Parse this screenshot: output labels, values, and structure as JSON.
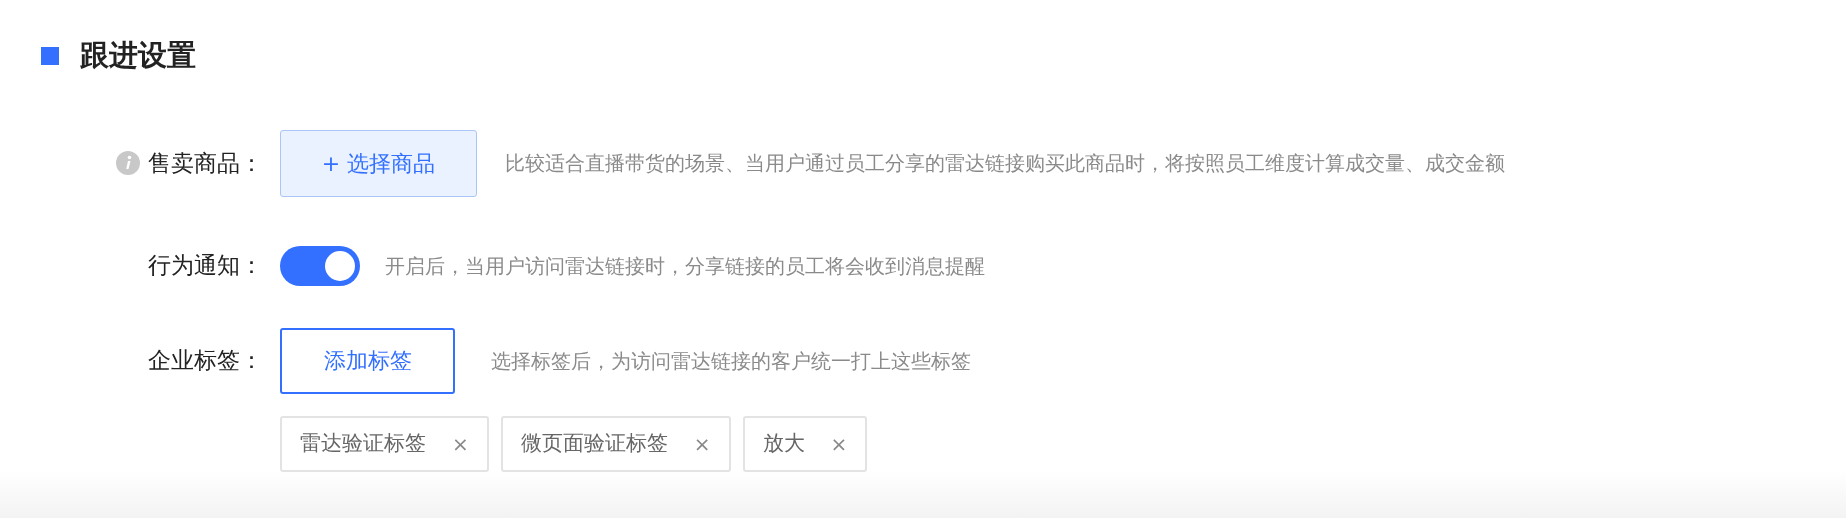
{
  "section_title": "跟进设置",
  "fields": [
    {
      "kind": "button",
      "label": "售卖商品：",
      "info": true,
      "button": "+ 选择商品",
      "hint": "比较适合直播带货的场景、当用户通过员工分享的雷达链接购买此商品时，将按照员工维度计算成交量、成交金额"
    },
    {
      "kind": "toggle",
      "label": "行为通知：",
      "on": true,
      "hint": "开启后，当用户访问雷达链接时，分享链接的员工将会收到消息提醒"
    },
    {
      "kind": "tags",
      "label": "企业标签：",
      "button": "添加标签",
      "hint": "选择标签后，为访问雷达链接的客户统一打上这些标签",
      "tags": [
        {
          "text": "雷达验证标签",
          "remove": "×"
        },
        {
          "text": "微页面验证标签",
          "remove": "×"
        },
        {
          "text": "放大",
          "remove": "×"
        }
      ]
    }
  ]
}
